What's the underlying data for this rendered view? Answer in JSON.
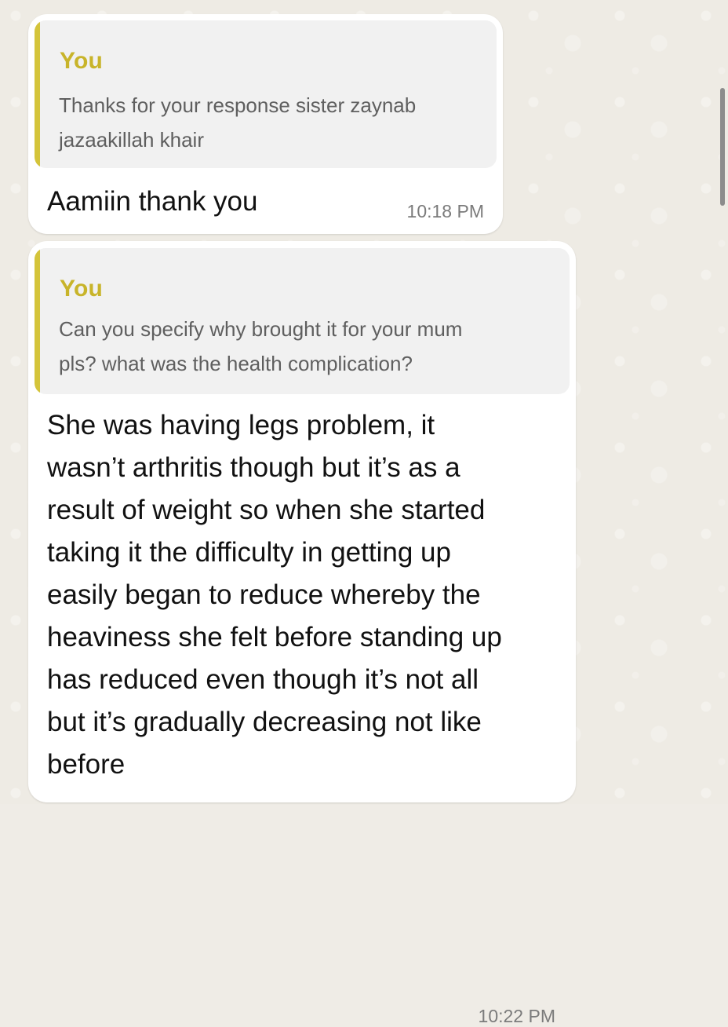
{
  "messages": [
    {
      "quote": {
        "author": "You",
        "text": "Thanks for your response sister zaynab\njazaakillah khair"
      },
      "text": "Aamiin thank you",
      "time": "10:18 PM"
    },
    {
      "quote": {
        "author": "You",
        "text": "Can you specify why brought it for your mum\npls? what was the health complication?"
      },
      "text": "She was having legs problem, it\nwasn’t arthritis though but it’s as a\nresult of weight so when she started\ntaking it the difficulty in getting up\neasily began to reduce whereby the\nheaviness she felt before standing up\nhas reduced even though it’s not all\nbut it’s gradually decreasing not like\nbefore",
      "time": "10:22 PM"
    }
  ],
  "colors": {
    "background": "#eeebe4",
    "bubble": "#ffffff",
    "quote_background": "#f1f1f1",
    "quote_accent": "#d4c43a",
    "quote_author": "#c8b42a",
    "timestamp": "#7b7b7b"
  }
}
